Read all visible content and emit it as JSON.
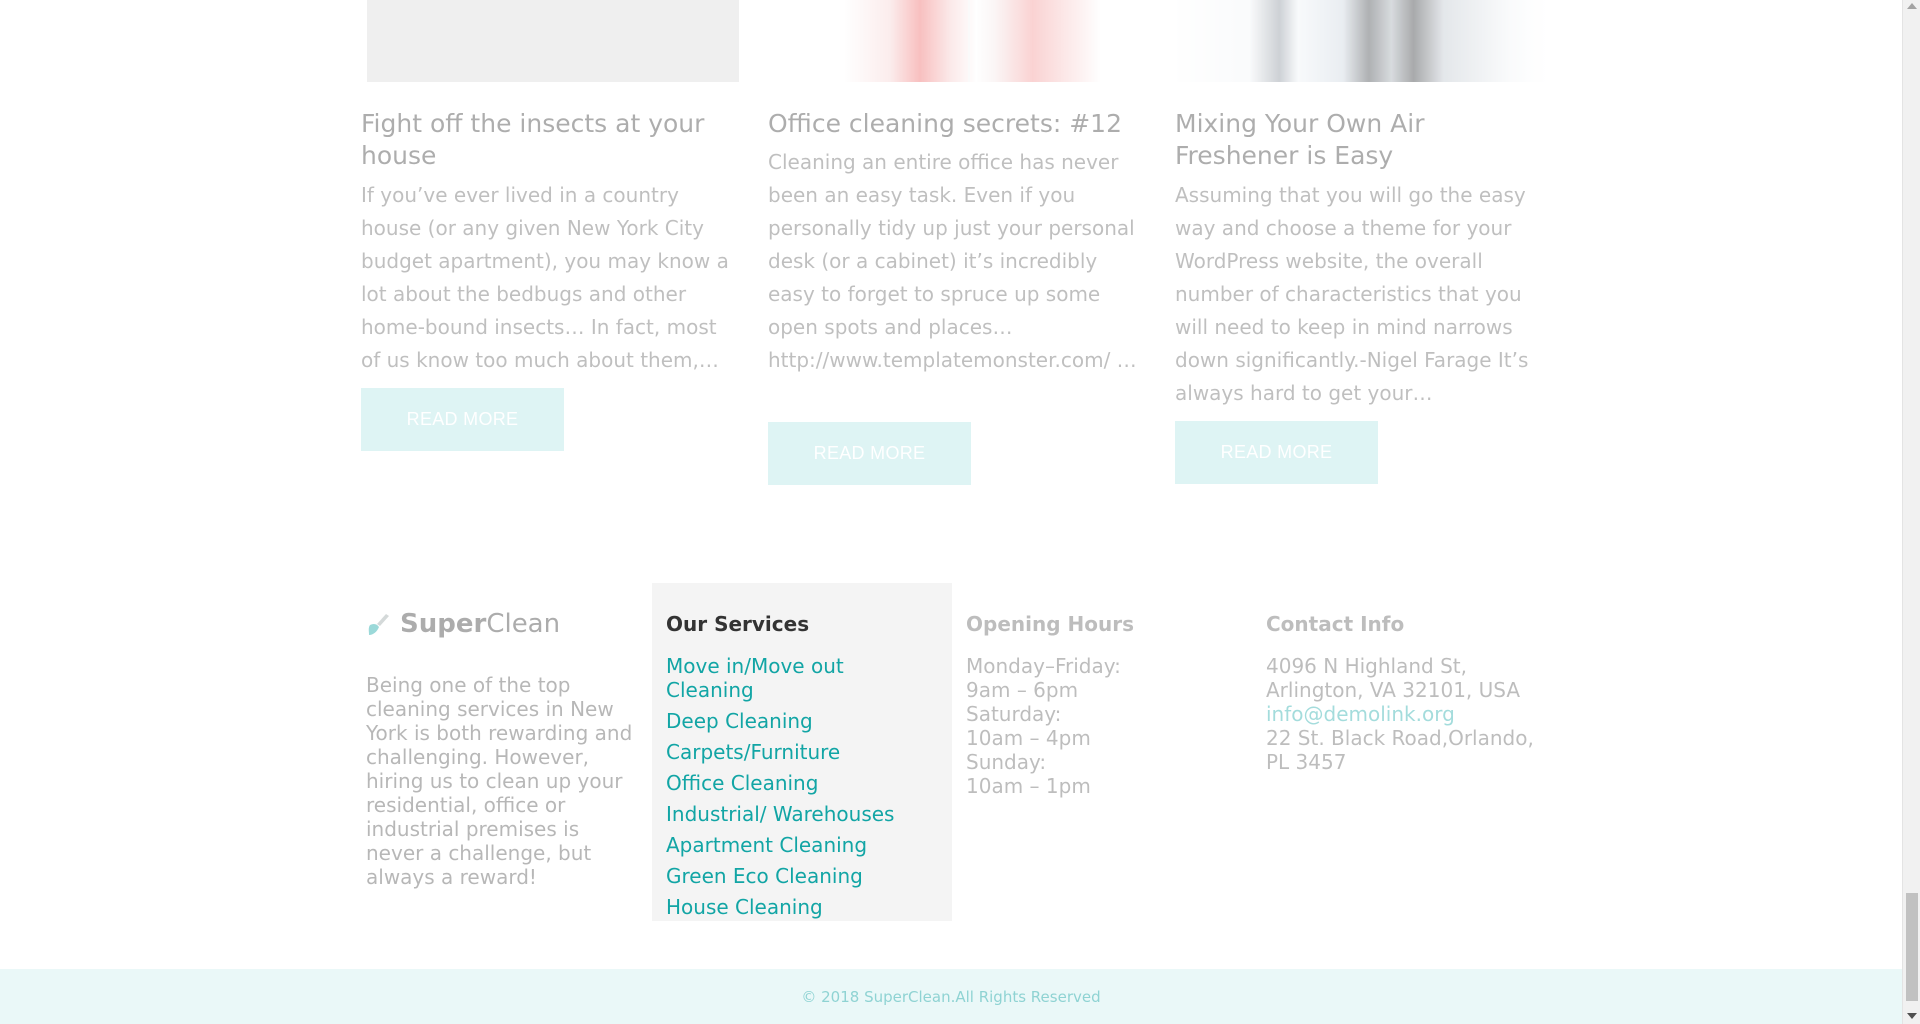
{
  "posts": [
    {
      "title": "Fight off the insects at your house",
      "excerpt": "   If you’ve ever lived in a country house (or any given New York City budget apartment), you may know a lot about the bedbugs and other home-bound insects… In fact, most of us know too much about them,…",
      "button": "READ MORE"
    },
    {
      "title": "Office cleaning secrets: #12",
      "excerpt": "  Cleaning an entire office has never been an easy task. Even if you personally tidy up just your personal desk (or a cabinet) it’s incredibly easy to forget to spruce up some open spots and places… http://www.templatemonster.com/ …",
      "button": "READ MORE"
    },
    {
      "title": "Mixing Your Own Air Freshener is Easy",
      "excerpt": "Assuming that you will go the easy way and choose a theme for your WordPress website, the overall number of characteristics that you will need to keep in mind narrows down significantly.-Nigel Farage   It’s always hard to get your…",
      "button": "READ MORE"
    }
  ],
  "footer": {
    "brand_strong": "Super",
    "brand_light": "Clean",
    "about": "Being one of the top cleaning services in New York is both rewarding and challenging. However, hiring us to clean up your residential, office or industrial premises is never a challenge, but always a reward!",
    "services_title": "Our Services",
    "services": [
      "Move in/Move out Cleaning",
      "Deep Cleaning",
      "Carpets/Furniture",
      "Office Cleaning",
      "Industrial/ Warehouses",
      "Apartment Cleaning",
      "Green Eco Cleaning",
      "House Cleaning"
    ],
    "hours_title": "Opening Hours",
    "hours": [
      "Monday–Friday:",
      "9am – 6pm",
      "Saturday:",
      "10am – 4pm",
      "Sunday:",
      "10am – 1pm"
    ],
    "contact_title": "Contact Info",
    "contact_address_1": "4096 N Highland St, Arlington, VA 32101, USA",
    "contact_email": "info@demolink.org",
    "contact_address_2": "22 St. Black Road,Orlando, PL 3457",
    "copyright": "© 2018 SuperClean.All Rights Reserved"
  },
  "colors": {
    "accent": "#12a5a5",
    "button_bg": "#a9e3e3",
    "bottom_bar": "#eaf8f8"
  },
  "icons": {
    "brand": "broom-icon"
  }
}
